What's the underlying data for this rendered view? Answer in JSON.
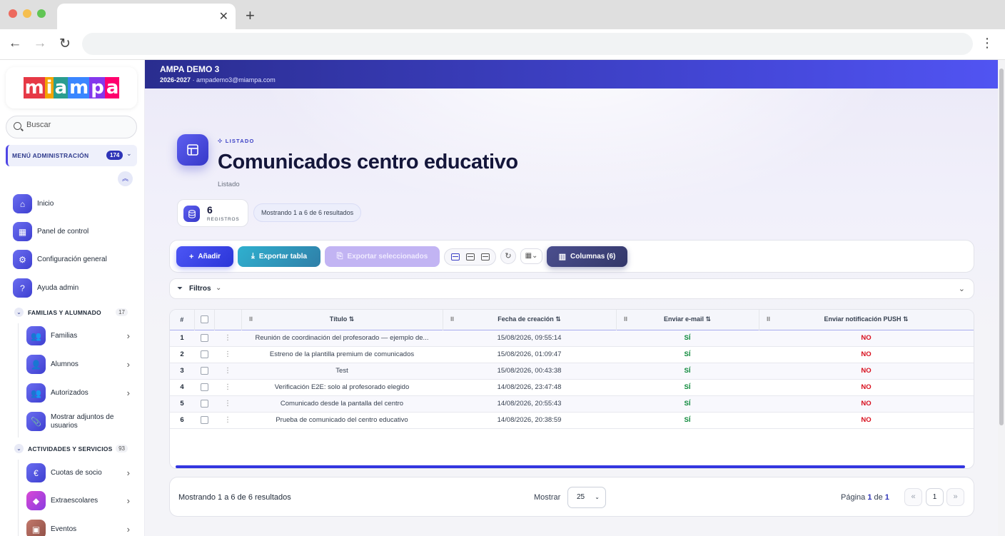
{
  "browser": {
    "tab_close": "✕",
    "new_tab": "+",
    "nav_back": "←",
    "nav_forward": "→",
    "nav_reload": "↻",
    "menu": "⋮"
  },
  "sidebar": {
    "logo": [
      "m",
      "i",
      "a",
      "m",
      "p",
      "a"
    ],
    "logo_colors": [
      "#e63946",
      "#f4a300",
      "#2a9d8f",
      "#3a86ff",
      "#8338ec",
      "#ff006e"
    ],
    "search_placeholder": "Buscar",
    "admin_menu": {
      "label": "MENÚ ADMINISTRACIÓN",
      "badge": "174"
    },
    "top_items": [
      {
        "label": "Inicio",
        "icon": "home-icon"
      },
      {
        "label": "Panel de control",
        "icon": "dashboard-icon"
      },
      {
        "label": "Configuración general",
        "icon": "settings-icon"
      },
      {
        "label": "Ayuda admin",
        "icon": "help-icon"
      }
    ],
    "sections": [
      {
        "label": "FAMILIAS Y ALUMNADO",
        "count": "17",
        "items": [
          {
            "label": "Familias",
            "icon": "users-icon"
          },
          {
            "label": "Alumnos",
            "icon": "user-icon"
          },
          {
            "label": "Autorizados",
            "icon": "users-icon"
          },
          {
            "label": "Mostrar adjuntos de usuarios",
            "icon": "paperclip-icon"
          }
        ]
      },
      {
        "label": "ACTIVIDADES Y SERVICIOS",
        "count": "93",
        "items": [
          {
            "label": "Cuotas de socio",
            "icon": "euro-icon"
          },
          {
            "label": "Extraescolares",
            "icon": "diamond-icon"
          },
          {
            "label": "Eventos",
            "icon": "calendar-icon"
          }
        ]
      }
    ]
  },
  "banner": {
    "title": "AMPA DEMO 3",
    "year": "2026-2027",
    "email": "· ampademo3@miampa.com"
  },
  "header": {
    "eyebrow": "LISTADO",
    "title": "Comunicados centro educativo",
    "subtitle": "Listado",
    "count": "6",
    "count_label": "REGISTROS",
    "showing": "Mostrando 1 a 6 de 6 resultados"
  },
  "toolbar": {
    "add_label": "Añadir",
    "export_label": "Exportar tabla",
    "export_selected_label": "Exportar seleccionados",
    "columns_label": "Columnas (6)"
  },
  "filters": {
    "label": "Filtros"
  },
  "table": {
    "headers": {
      "num": "#",
      "title": "Título ⇅",
      "created": "Fecha de creación ⇅",
      "email": "Enviar e-mail ⇅",
      "push": "Enviar notificación PUSH ⇅"
    },
    "rows": [
      {
        "num": "1",
        "title": "Reunión de coordinación del profesorado — ejemplo de...",
        "created": "15/08/2026, 09:55:14",
        "email": "SÍ",
        "push": "NO"
      },
      {
        "num": "2",
        "title": "Estreno de la plantilla premium de comunicados",
        "created": "15/08/2026, 01:09:47",
        "email": "SÍ",
        "push": "NO"
      },
      {
        "num": "3",
        "title": "Test",
        "created": "15/08/2026, 00:43:38",
        "email": "SÍ",
        "push": "NO"
      },
      {
        "num": "4",
        "title": "Verificación E2E: solo al profesorado elegido",
        "created": "14/08/2026, 23:47:48",
        "email": "SÍ",
        "push": "NO"
      },
      {
        "num": "5",
        "title": "Comunicado desde la pantalla del centro",
        "created": "14/08/2026, 20:55:43",
        "email": "SÍ",
        "push": "NO"
      },
      {
        "num": "6",
        "title": "Prueba de comunicado del centro educativo",
        "created": "14/08/2026, 20:38:59",
        "email": "SÍ",
        "push": "NO"
      }
    ]
  },
  "pager": {
    "info": "Mostrando 1 a 6 de 6 resultados",
    "show_label": "Mostrar",
    "page_size": "25",
    "page_prefix": "Página ",
    "page_current": "1",
    "page_of": " de ",
    "page_total": "1",
    "prev": "«",
    "current_btn": "1",
    "next": "»"
  },
  "colors": {
    "accent": "#3b40c5",
    "si": "#0f8a3c",
    "no": "#d80f1d"
  }
}
